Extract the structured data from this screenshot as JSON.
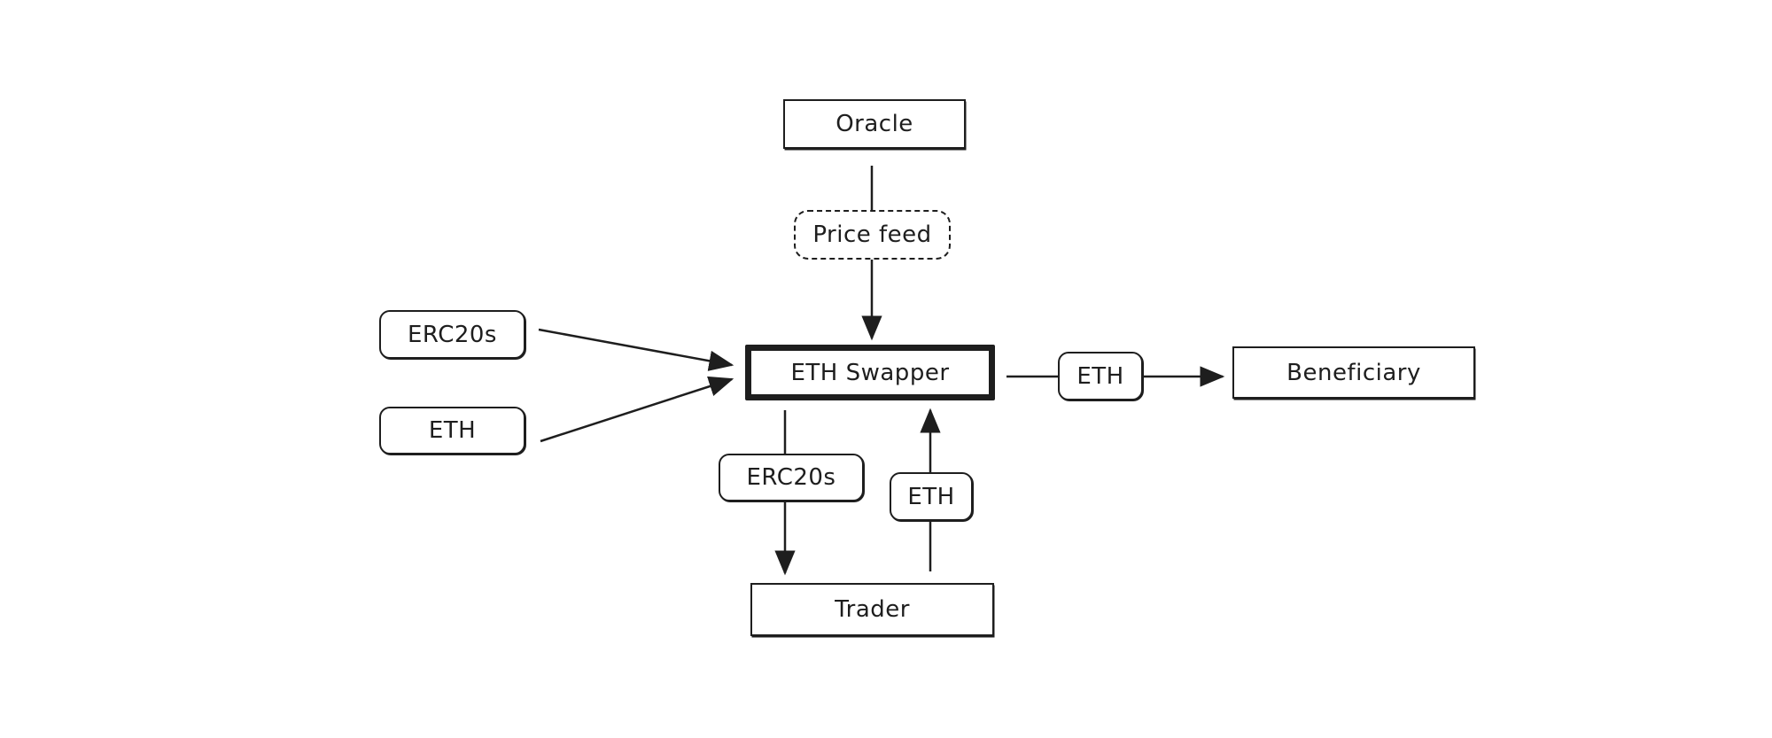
{
  "diagram": {
    "nodes": {
      "oracle": {
        "label": "Oracle"
      },
      "price_feed": {
        "label": "Price feed"
      },
      "eth_swapper": {
        "label": "ETH Swapper"
      },
      "erc20s_in": {
        "label": "ERC20s"
      },
      "eth_in": {
        "label": "ETH"
      },
      "eth_out": {
        "label": "ETH"
      },
      "beneficiary": {
        "label": "Beneficiary"
      },
      "erc20s_trader": {
        "label": "ERC20s"
      },
      "eth_trader": {
        "label": "ETH"
      },
      "trader": {
        "label": "Trader"
      }
    },
    "edges": [
      {
        "from": "Oracle",
        "via": "Price feed",
        "to": "ETH Swapper"
      },
      {
        "from": "ERC20s",
        "to": "ETH Swapper"
      },
      {
        "from": "ETH",
        "to": "ETH Swapper"
      },
      {
        "from": "ETH Swapper",
        "via": "ETH",
        "to": "Beneficiary"
      },
      {
        "from": "ETH Swapper",
        "via": "ERC20s",
        "to": "Trader"
      },
      {
        "from": "Trader",
        "via": "ETH",
        "to": "ETH Swapper"
      }
    ],
    "colors": {
      "stroke": "#1e1e1e",
      "background": "#ffffff"
    }
  }
}
